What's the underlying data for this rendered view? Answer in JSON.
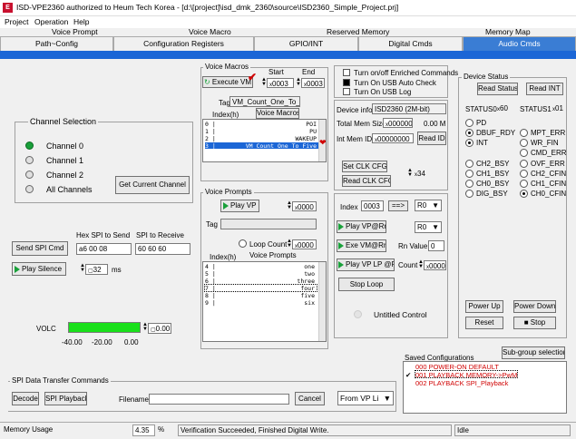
{
  "window": {
    "title": "ISD-VPE2360 authorized to Heum Tech Korea - [d:\\[project]\\isd_dmk_2360\\source\\ISD2360_Simple_Project.prj]"
  },
  "menu": [
    "Project",
    "Operation",
    "Help"
  ],
  "tabs_row1": [
    "Voice Prompt",
    "Voice Macro",
    "Reserved Memory",
    "Memory Map"
  ],
  "tabs_row2": [
    "Path~Config",
    "Configuration Registers",
    "GPIO/INT",
    "Digital Cmds",
    "Audio Cmds"
  ],
  "channel": {
    "title": "Channel Selection",
    "options": [
      "Channel 0",
      "Channel 1",
      "Channel 2",
      "All Channels"
    ],
    "selected": 0,
    "get_current_label": "Get Current Channel"
  },
  "spi": {
    "hex_label": "Hex SPI to Send",
    "receive_label": "SPI to Receive",
    "send_button": "Send SPI Cmd",
    "send_value": "a6 00 08",
    "receive_value": "60 60 60",
    "play_silence": "Play Silence",
    "silence_value": "32",
    "ms_label": "ms"
  },
  "volc": {
    "label": "VOLC",
    "ticks": [
      "-40.00",
      "-20.00",
      "0.00"
    ],
    "value": "0.00",
    "level_fraction": 1.0
  },
  "spi_transfer": {
    "title": "SPI Data Transfer Commands",
    "decode": "Decode",
    "playback": "SPI Playback",
    "filename_label": "Filename",
    "filename_value": "",
    "cancel": "Cancel",
    "source_select": "From VP Li"
  },
  "macros": {
    "title": "Voice Macros",
    "start_label": "Start",
    "end_label": "End",
    "execute": "Execute VM",
    "start_value": "0003",
    "end_value": "0003",
    "tag_label": "Tag",
    "tag_value": "VM_Count_One_To_Fi",
    "index_label": "Index(h)",
    "list_header": "Voice Macros",
    "rows": [
      {
        "i": "0",
        "name": "POI"
      },
      {
        "i": "1",
        "name": "PU"
      },
      {
        "i": "2",
        "name": "WAKEUP"
      },
      {
        "i": "3",
        "name": "VM_Count_One_To_Five"
      }
    ],
    "selected": 3
  },
  "prompts": {
    "title": "Voice Prompts",
    "play": "Play VP",
    "play_value": "0000",
    "tag_label": "Tag",
    "tag_value": "",
    "loop_label": "Loop Count",
    "loop_value": "0000",
    "index_label": "Index(h)",
    "list_header": "Voice Prompts",
    "rows": [
      {
        "i": "4",
        "name": "one"
      },
      {
        "i": "5",
        "name": "two"
      },
      {
        "i": "6",
        "name": "three"
      },
      {
        "i": "7",
        "name": "four"
      },
      {
        "i": "8",
        "name": "five"
      },
      {
        "i": "9",
        "name": "six"
      }
    ]
  },
  "options": {
    "items": [
      "Turn on/off Enriched Commands",
      "Turn On USB Auto Check",
      "Turn On USB Log"
    ],
    "checked": [
      false,
      true,
      false
    ]
  },
  "device": {
    "info_label": "Device info",
    "info_value": "ISD2360 (2M-bit)",
    "mem_label": "Total Mem Size",
    "mem_value": "000000",
    "mem_unit": "0.00  M",
    "id_label": "Int Mem ID",
    "id_value": "00000000",
    "read_id": "Read ID",
    "set_clk": "Set CLK CFG",
    "read_clk": "Read CLK CFG",
    "clk_value": "34"
  },
  "index_panel": {
    "index_label": "Index",
    "index_value": "0003",
    "arrow": "==>",
    "r0a": "R0",
    "play_vp_rn": "Play VP@Rn",
    "r0b": "R0",
    "exe_vm_rn": "Exe VM@Rn",
    "rn_label": "Rn Value",
    "rn_value": "0",
    "play_vp_lp": "Play VP LP @Rn",
    "count_label": "Count",
    "count_value": "0000",
    "stop_loop": "Stop Loop",
    "untitled": "Untitled Control"
  },
  "status": {
    "title": "Device Status",
    "read_status": "Read Status",
    "read_int": "Read INT",
    "status0": "STATUS0",
    "status0_val": "60",
    "status1": "STATUS1",
    "status1_val": "01",
    "left": [
      "PD",
      "DBUF_RDY",
      "INT",
      "",
      "CH2_BSY",
      "CH1_BSY",
      "CH0_BSY",
      "DIG_BSY"
    ],
    "left_on": [
      false,
      true,
      true,
      false,
      false,
      false,
      false,
      false
    ],
    "right": [
      "MPT_ERR",
      "WR_FIN",
      "CMD_ERR",
      "OVF_ERR",
      "CH2_CFIN",
      "CH1_CFIN",
      "CH0_CFIN"
    ],
    "right_on": [
      false,
      false,
      false,
      false,
      false,
      false,
      true
    ],
    "power_up": "Power Up",
    "power_down": "Power Down",
    "reset": "Reset",
    "stop": "Stop"
  },
  "configs": {
    "title": "Saved Configurations",
    "subgroup": "Sub-group selection",
    "items": [
      "000 POWER-ON DEFAULT",
      "001 PLAYBACK MEMORY->PwM",
      "002 PLAYBACK SPI_Playback"
    ],
    "checked": 1
  },
  "statusbar": {
    "mem_label": "Memory Usage",
    "mem_value": "4.35",
    "pct": "%",
    "message": "Verification Succeeded, Finished Digital Write.",
    "state": "Idle"
  },
  "colors": {
    "accent": "#1b66d6",
    "led_on": "#19a03a",
    "red_text": "#d00000"
  }
}
